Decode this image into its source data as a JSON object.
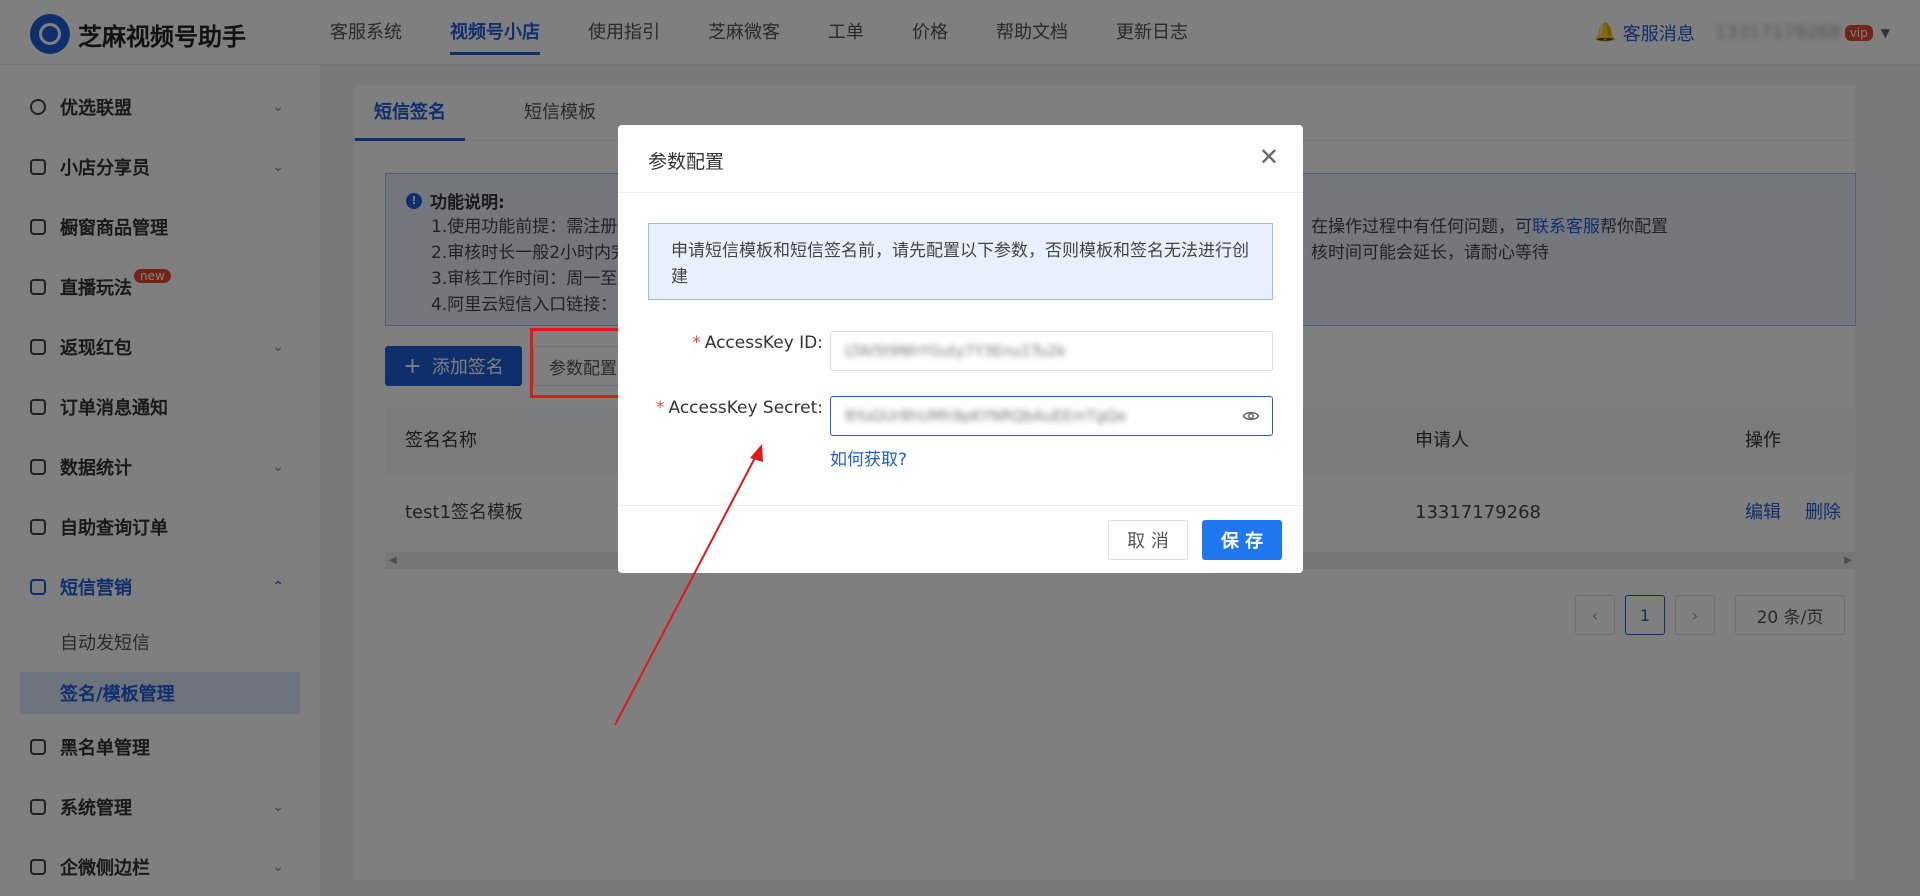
{
  "app": {
    "title": "芝麻视频号助手"
  },
  "nav": {
    "items": [
      "客服系统",
      "视频号小店",
      "使用指引",
      "芝麻微客",
      "工单",
      "价格",
      "帮助文档",
      "更新日志"
    ],
    "active": "视频号小店"
  },
  "topright": {
    "messages": "客服消息",
    "phone": "13317179268",
    "vip": "vip"
  },
  "sidebar": {
    "items": [
      {
        "label": "优选联盟",
        "icon": "medal-icon"
      },
      {
        "label": "小店分享员",
        "icon": "users-icon"
      },
      {
        "label": "橱窗商品管理",
        "icon": "goods-icon"
      },
      {
        "label": "直播玩法",
        "icon": "play-icon",
        "badge": "new"
      },
      {
        "label": "返现红包",
        "icon": "redpacket-icon"
      },
      {
        "label": "订单消息通知",
        "icon": "order-icon"
      },
      {
        "label": "数据统计",
        "icon": "chart-icon"
      },
      {
        "label": "自助查询订单",
        "icon": "search-doc-icon"
      },
      {
        "label": "短信营销",
        "icon": "sms-icon"
      },
      {
        "label": "黑名单管理",
        "icon": "blacklist-icon"
      },
      {
        "label": "系统管理",
        "icon": "system-icon"
      },
      {
        "label": "企微侧边栏",
        "icon": "sidebar-icon"
      }
    ],
    "sub_items": [
      "自动发短信",
      "签名/模板管理"
    ]
  },
  "tabs": [
    "短信签名",
    "短信模板"
  ],
  "notice": {
    "title": "功能说明:",
    "lines": [
      "1.使用功能前提：需注册",
      "2.审核时长一般2小时内完",
      "3.审核工作时间：周一至",
      "4.阿里云短信入口链接："
    ],
    "right_lines": [
      "在操作过程中有任何问题，可",
      "核时间可能会延长，请耐心等待"
    ],
    "link": "联系客服",
    "after_link": "帮你配置"
  },
  "buttons": {
    "add": "添加签名",
    "param": "参数配置"
  },
  "table": {
    "headers": [
      "签名名称",
      "申请人",
      "操作"
    ],
    "rows": [
      {
        "name": "test1签名模板",
        "applicant": "13317179268",
        "edit": "编辑",
        "delete": "删除"
      }
    ]
  },
  "pagination": {
    "current": "1",
    "page_size": "20 条/页"
  },
  "modal": {
    "title": "参数配置",
    "info": "申请短信模板和短信签名前，请先配置以下参数，否则模板和签名无法进行创建",
    "fields": [
      {
        "label": "AccessKey ID",
        "value": "LTAI5t9NhYGuty7Y3Enu1Tu2k"
      },
      {
        "label": "AccessKey Secret",
        "value": "8YuGUr8hUMh9pKYNRQbAuEEmTgQe"
      }
    ],
    "help_link": "如何获取?",
    "cancel": "取 消",
    "save": "保 存"
  },
  "colors": {
    "brand": "#1f5ed8",
    "save": "#1f77f0",
    "highlight": "#e21818"
  }
}
